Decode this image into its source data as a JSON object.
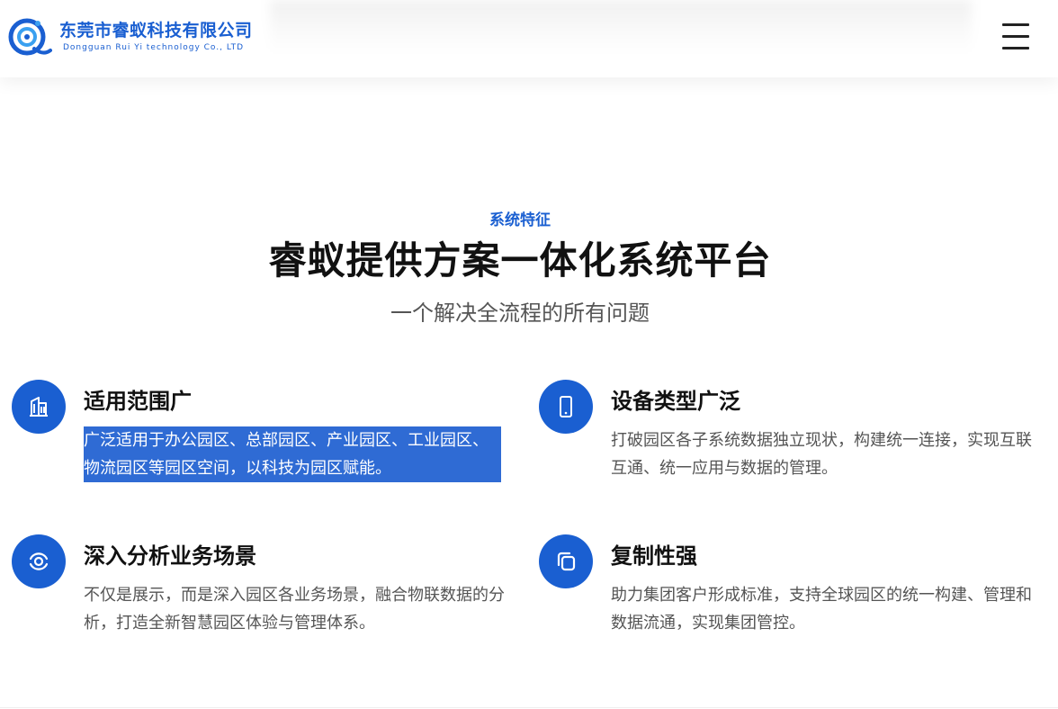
{
  "header": {
    "company_cn": "东莞市睿蚁科技有限公司",
    "company_en": "Dongguan Rui Yi technology Co., LTD",
    "menu_icon": "hamburger-menu-icon"
  },
  "section": {
    "eyebrow": "系统特征",
    "title": "睿蚁提供方案一体化系统平台",
    "subtitle": "一个解决全流程的所有问题"
  },
  "features": [
    {
      "icon": "building-icon",
      "title": "适用范围广",
      "desc": "广泛适用于办公园区、总部园区、产业园区、工业园区、物流园区等园区空间，以科技为园区赋能。"
    },
    {
      "icon": "mobile-device-icon",
      "title": "设备类型广泛",
      "desc": "打破园区各子系统数据独立现状，构建统一连接，实现互联互通、统一应用与数据的管理。"
    },
    {
      "icon": "analysis-eye-icon",
      "title": "深入分析业务场景",
      "desc": "不仅是展示，而是深入园区各业务场景，融合物联数据的分析，打造全新智慧园区体验与管理体系。"
    },
    {
      "icon": "copy-icon",
      "title": "复制性强",
      "desc": "助力集团客户形成标准，支持全球园区的统一构建、管理和数据流通，实现集团管控。"
    }
  ],
  "colors": {
    "accent": "#1a5fd1",
    "selection": "#2f6bd4"
  }
}
